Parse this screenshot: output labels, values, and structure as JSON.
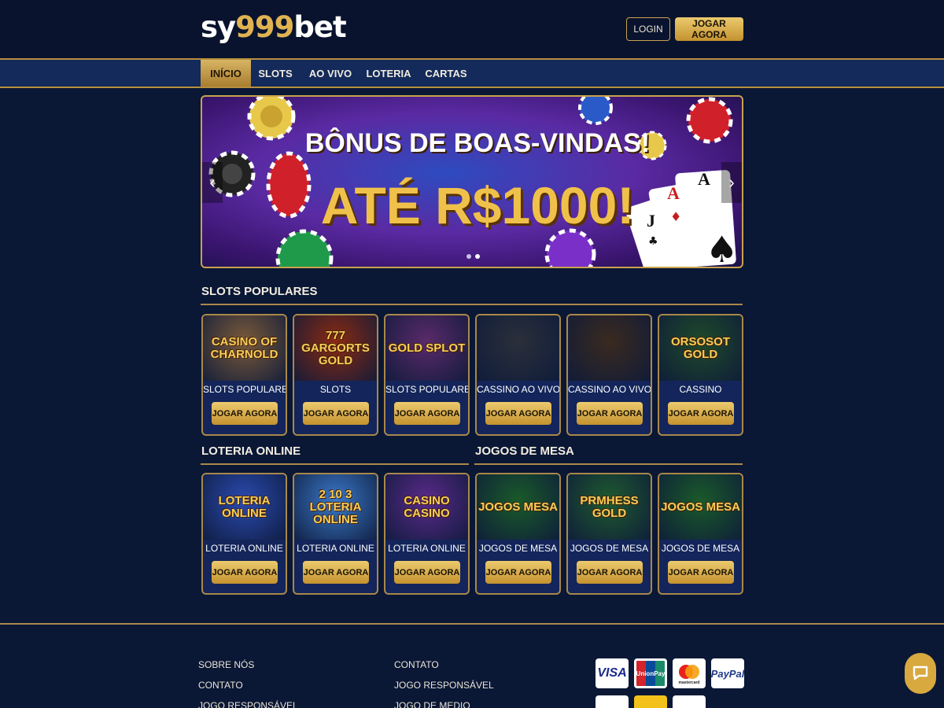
{
  "header": {
    "logo_part1": "sy",
    "logo_part2": "999",
    "logo_part3": "bet",
    "login_label": "LOGIN",
    "play_now_label": "JOGAR AGORA"
  },
  "nav": {
    "items": [
      {
        "label": "INÍCIO",
        "active": true
      },
      {
        "label": "SLOTS",
        "active": false
      },
      {
        "label": "AO VIVO",
        "active": false
      },
      {
        "label": "LOTERIA",
        "active": false
      },
      {
        "label": "CARTAS",
        "active": false
      }
    ]
  },
  "banner": {
    "line1": "BÔNUS DE BOAS-VINDAS!",
    "line2": "ATÉ R$1000!",
    "prev_icon": "chevron-left-icon",
    "next_icon": "chevron-right-icon"
  },
  "sections": {
    "slots_title": "SLOTS POPULARES",
    "loteria_title": "LOTERIA ONLINE",
    "mesa_title": "JOGOS DE MESA"
  },
  "row1": [
    {
      "thumb": "CASINO OF CHARNOLD",
      "label": "SLOTS POPULARES",
      "button": "JOGAR AGORA",
      "bg": "#7a5a3a"
    },
    {
      "thumb": "777 GARGORTS GOLD",
      "label": "SLOTS",
      "button": "JOGAR AGORA",
      "bg": "#8a2a12"
    },
    {
      "thumb": "GOLD SPLOT",
      "label": "SLOTS POPULARES",
      "button": "JOGAR AGORA",
      "bg": "#5a2a6a"
    },
    {
      "thumb": "",
      "label": "CASSINO AO VIVO",
      "button": "JOGAR AGORA",
      "bg": "#2a2f3a"
    },
    {
      "thumb": "",
      "label": "CASSINO AO VIVO",
      "button": "JOGAR AGORA",
      "bg": "#3a2a1f"
    },
    {
      "thumb": "ORSOSOT GOLD",
      "label": "CASSINO",
      "button": "JOGAR AGORA",
      "bg": "#1f4a2a"
    }
  ],
  "row2": [
    {
      "thumb": "LOTERIA ONLINE",
      "label": "LOTERIA ONLINE",
      "button": "JOGAR AGORA",
      "bg": "#2a4ab0"
    },
    {
      "thumb": "2 10 3 LOTERIA ONLINE",
      "label": "LOTERIA ONLINE",
      "button": "JOGAR AGORA",
      "bg": "#3a78c8"
    },
    {
      "thumb": "CASINO CASINO",
      "label": "LOTERIA ONLINE",
      "button": "JOGAR AGORA",
      "bg": "#5a2a8a"
    },
    {
      "thumb": "JOGOS MESA",
      "label": "JOGOS DE MESA",
      "button": "JOGAR AGORA",
      "bg": "#1a5a2a"
    },
    {
      "thumb": "PRMHESS GOLD",
      "label": "JOGOS DE MESA",
      "button": "JOGAR AGORA",
      "bg": "#1f5a2f"
    },
    {
      "thumb": "JOGOS MESA",
      "label": "JOGOS DE MESA",
      "button": "JOGAR AGORA",
      "bg": "#1a5a2a"
    }
  ],
  "footer": {
    "col1": [
      "SOBRE NÓS",
      "CONTATO",
      "JOGO RESPONSÁVEL"
    ],
    "col2": [
      "CONTATO",
      "JOGO RESPONSÁVEL",
      "JOGO DE MEDIO"
    ],
    "payments": [
      "VISA",
      "UnionPay",
      "mastercard",
      "PayPal"
    ],
    "chat_icon": "chat-bubble-icon"
  },
  "colors": {
    "gold": "#c9a24f",
    "navy": "#0a1735",
    "nav_bg": "#132a5a"
  }
}
